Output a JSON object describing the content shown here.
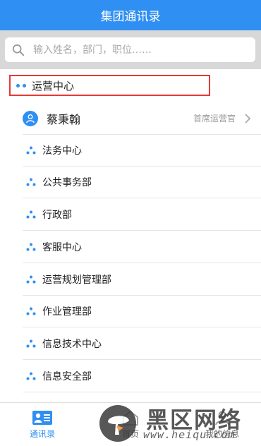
{
  "header": {
    "title": "集团通讯录"
  },
  "search": {
    "placeholder": "输入姓名，部门，职位……"
  },
  "org": {
    "label": "运营中心"
  },
  "person": {
    "name": "蔡秉翰",
    "title": "首席运营官"
  },
  "departments": [
    {
      "label": "法务中心"
    },
    {
      "label": "公共事务部"
    },
    {
      "label": "行政部"
    },
    {
      "label": "客服中心"
    },
    {
      "label": "运营规划管理部"
    },
    {
      "label": "作业管理部"
    },
    {
      "label": "信息技术中心"
    },
    {
      "label": "信息安全部"
    }
  ],
  "tabs": [
    {
      "label": "通讯录",
      "icon": "contacts-icon",
      "active": true
    },
    {
      "label": "首页",
      "icon": "home-icon",
      "active": false
    },
    {
      "label": "我的信息",
      "icon": "profile-icon",
      "active": false
    }
  ],
  "watermark": {
    "brand": "黑区网络",
    "url": "www.heiqu.com"
  },
  "colors": {
    "accent": "#2f8ff2",
    "highlight_border": "#e53935"
  }
}
